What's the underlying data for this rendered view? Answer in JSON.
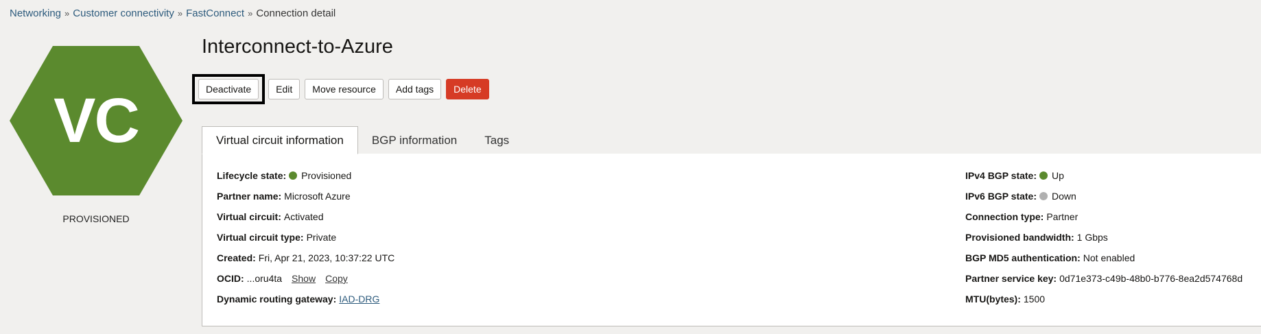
{
  "breadcrumb": {
    "items": [
      "Networking",
      "Customer connectivity",
      "FastConnect"
    ],
    "separator": "»",
    "current": "Connection detail"
  },
  "resource": {
    "icon_text": "VC",
    "icon_color": "#5b8a2e",
    "status": "PROVISIONED",
    "title": "Interconnect-to-Azure"
  },
  "actions": {
    "deactivate": "Deactivate",
    "edit": "Edit",
    "move": "Move resource",
    "add_tags": "Add tags",
    "delete": "Delete"
  },
  "tabs": [
    "Virtual circuit information",
    "BGP information",
    "Tags"
  ],
  "colors": {
    "status_green": "#5b8a2e",
    "status_gray": "#b0b0b0",
    "danger": "#d63b25",
    "link": "#2c5a7c"
  },
  "info": {
    "lifecycle_label": "Lifecycle state:",
    "lifecycle_value": "Provisioned",
    "partner_label": "Partner name:",
    "partner_value": "Microsoft Azure",
    "vc_label": "Virtual circuit:",
    "vc_value": "Activated",
    "vc_type_label": "Virtual circuit type:",
    "vc_type_value": "Private",
    "created_label": "Created:",
    "created_value": "Fri, Apr 21, 2023, 10:37:22 UTC",
    "ocid_label": "OCID:",
    "ocid_value": "...oru4ta",
    "ocid_show": "Show",
    "ocid_copy": "Copy",
    "drg_label": "Dynamic routing gateway:",
    "drg_value": "IAD-DRG",
    "ipv4_label": "IPv4 BGP state:",
    "ipv4_value": "Up",
    "ipv6_label": "IPv6 BGP state:",
    "ipv6_value": "Down",
    "conn_type_label": "Connection type:",
    "conn_type_value": "Partner",
    "bandwidth_label": "Provisioned bandwidth:",
    "bandwidth_value": "1 Gbps",
    "md5_label": "BGP MD5 authentication:",
    "md5_value": "Not enabled",
    "psk_label": "Partner service key:",
    "psk_value": "0d71e373-c49b-48b0-b776-8ea2d574768d",
    "mtu_label": "MTU(bytes):",
    "mtu_value": "1500"
  }
}
